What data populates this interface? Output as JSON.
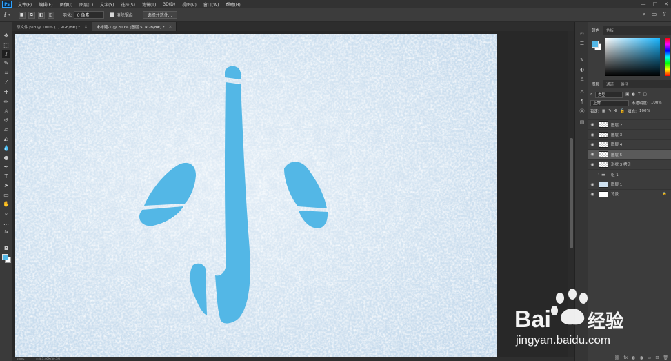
{
  "menubar": {
    "logo": "Ps",
    "items": [
      "文件(F)",
      "编辑(E)",
      "图像(I)",
      "图层(L)",
      "文字(Y)",
      "选择(S)",
      "滤镜(T)",
      "3D(D)",
      "视图(V)",
      "窗口(W)",
      "帮助(H)"
    ],
    "window_controls": [
      "—",
      "□",
      "✕"
    ]
  },
  "optbar": {
    "feather_label": "羽化:",
    "feather_value": "0 像素",
    "antialias_label": "消除锯齿",
    "select_mask_label": "选择并遮住...",
    "right_icons": [
      "⌕",
      "▭",
      "⇪"
    ]
  },
  "tabs": [
    {
      "label": "原文件.psd @ 100% (1, RGB/8#) *",
      "active": false,
      "close": "×"
    },
    {
      "label": "未标题-1 @ 200% (图层 5, RGB/8#) *",
      "active": true,
      "close": "×"
    }
  ],
  "statusbar": {
    "zoom": "200%",
    "doc": "文档:1.46M/30.5M"
  },
  "canvas": {
    "character": "小",
    "glyph_color": "#53b7e6",
    "snow_base_color": "#dceaf6"
  },
  "color_panel": {
    "tabs": [
      "颜色",
      "色板"
    ],
    "foreground": "#53b7e6",
    "background": "#ffffff"
  },
  "layers_panel": {
    "tabs": [
      "图层",
      "通道",
      "路径"
    ],
    "filter_label": "类型",
    "blend_mode": "正常",
    "opacity_label": "不透明度:",
    "opacity_value": "100%",
    "lock_label": "锁定:",
    "fill_label": "填充:",
    "fill_value": "100%",
    "layers": [
      {
        "name": "图层 2",
        "thumb": "transparent",
        "selected": false
      },
      {
        "name": "图层 3",
        "thumb": "transparent",
        "selected": false
      },
      {
        "name": "图层 4",
        "thumb": "transparent",
        "selected": false
      },
      {
        "name": "图层 5",
        "thumb": "transparent",
        "selected": true
      },
      {
        "name": "形状 3 拷贝",
        "thumb": "transparent",
        "selected": false
      },
      {
        "name": "组 1",
        "thumb": "folder",
        "selected": false
      },
      {
        "name": "图层 1",
        "thumb": "snow",
        "selected": false
      },
      {
        "name": "背景",
        "thumb": "white",
        "selected": false
      }
    ],
    "footer_icons": [
      "⛓",
      "fx",
      "◐",
      "◑",
      "▭",
      "⊞",
      "🗑"
    ]
  },
  "watermark": {
    "brand_left": "Bai",
    "brand_right": "经验",
    "url": "jingyan.baidu.com"
  }
}
